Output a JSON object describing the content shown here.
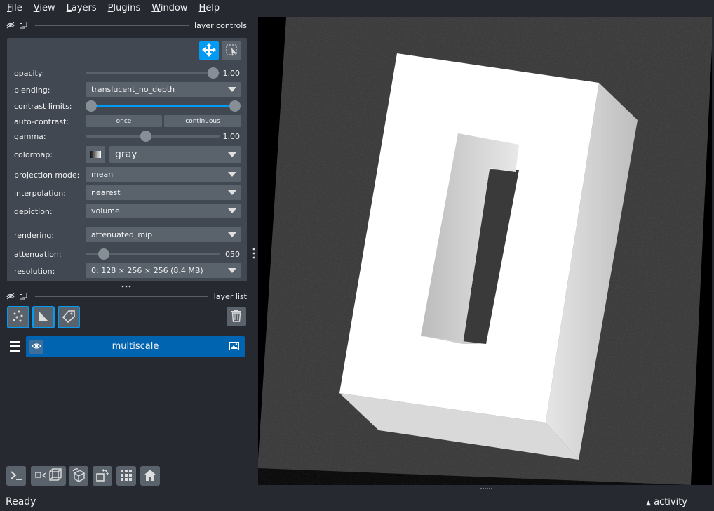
{
  "menu": [
    "File",
    "View",
    "Layers",
    "Plugins",
    "Window",
    "Help"
  ],
  "layer_controls": {
    "title": "layer controls",
    "opacity": {
      "label": "opacity:",
      "value": "1.00",
      "level": 1.0
    },
    "blending": {
      "label": "blending:",
      "value": "translucent_no_depth"
    },
    "contrast_limits": {
      "label": "contrast limits:",
      "low": 0.0,
      "high": 1.0
    },
    "auto_contrast": {
      "label": "auto-contrast:",
      "once": "once",
      "continuous": "continuous"
    },
    "gamma": {
      "label": "gamma:",
      "value": "1.00",
      "level": 0.45
    },
    "colormap": {
      "label": "colormap:",
      "value": "gray"
    },
    "projection_mode": {
      "label": "projection mode:",
      "value": "mean"
    },
    "interpolation": {
      "label": "interpolation:",
      "value": "nearest"
    },
    "depiction": {
      "label": "depiction:",
      "value": "volume"
    },
    "rendering": {
      "label": "rendering:",
      "value": "attenuated_mip"
    },
    "attenuation": {
      "label": "attenuation:",
      "value": "050",
      "level": 0.1
    },
    "resolution": {
      "label": "resolution:",
      "value": "0: 128 × 256 × 256 (8.4 MB)"
    }
  },
  "layer_list": {
    "title": "layer list",
    "layers": [
      {
        "name": "multiscale",
        "visible": true,
        "type_icon": "image-icon"
      }
    ]
  },
  "status": {
    "text": "Ready",
    "activity": "activity"
  },
  "colors": {
    "accent": "#009bf2",
    "selected": "#0064b0",
    "panel": "#414851",
    "bg": "#262930"
  }
}
